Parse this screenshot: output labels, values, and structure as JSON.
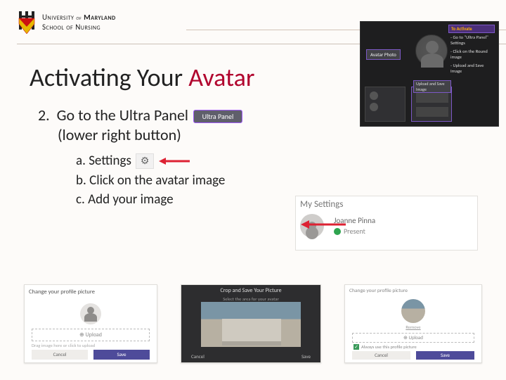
{
  "logo": {
    "university_pre": "University",
    "university_of": "of",
    "university_name": "Maryland",
    "school_line": "School of Nursing"
  },
  "title": {
    "black": "Activating Your ",
    "red": "Avatar"
  },
  "step": {
    "num": "2.",
    "line1": "Go to the Ultra Panel",
    "line2": "(lower right button)",
    "ultra_badge": "Ultra Panel"
  },
  "sub": {
    "a": "a.  Settings",
    "b": "b.  Click on the avatar image",
    "c": "c.  Add your image"
  },
  "diagram": {
    "avatar_label": "Avatar Photo",
    "activate_hdr": "To Activate",
    "activate_1": "- Go to \"Ultra Panel\" Settings",
    "activate_2": "- Click on the Round image",
    "activate_3": "- Upload and Save Image",
    "upload_label": "Upload and Save Image"
  },
  "mysettings": {
    "hdr": "My Settings",
    "name": "Joanne Pinna",
    "status": "Present"
  },
  "shot1": {
    "title": "Change your profile picture",
    "upload": "⊕ Upload",
    "caption": "Drag image here or click to upload",
    "cancel": "Cancel",
    "save": "Save"
  },
  "shot2": {
    "title": "Crop and Save Your Picture",
    "sub": "Select the area for your avatar",
    "cancel": "Cancel",
    "save": "Save"
  },
  "shot3": {
    "title": "Change your profile picture",
    "remove": "Remove",
    "upload": "⊕ Upload",
    "check": "Always use this profile picture",
    "cancel": "Cancel",
    "save": "Save"
  }
}
